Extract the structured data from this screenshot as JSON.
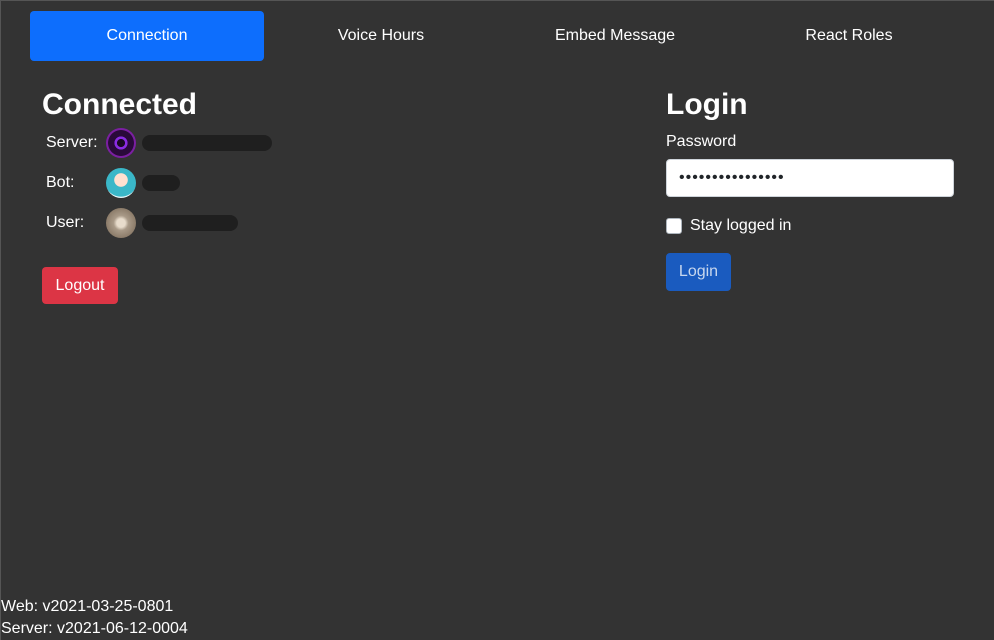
{
  "tabs": [
    {
      "label": "Connection",
      "active": true
    },
    {
      "label": "Voice Hours",
      "active": false
    },
    {
      "label": "Embed Message",
      "active": false
    },
    {
      "label": "React Roles",
      "active": false
    }
  ],
  "status": {
    "title": "Connected",
    "server_label": "Server:",
    "bot_label": "Bot:",
    "user_label": "User:",
    "logout_label": "Logout"
  },
  "login": {
    "title": "Login",
    "password_label": "Password",
    "password_value": "••••••••••••••••",
    "stay_logged_in_label": "Stay logged in",
    "stay_logged_in_checked": false,
    "login_button": "Login"
  },
  "footer": {
    "web_version": "Web: v2021-03-25-0801",
    "server_version": "Server: v2021-06-12-0004"
  },
  "colors": {
    "background": "#333333",
    "active_tab": "#0d6efd",
    "logout": "#dc3545",
    "login_button": "#1a5bbf"
  }
}
